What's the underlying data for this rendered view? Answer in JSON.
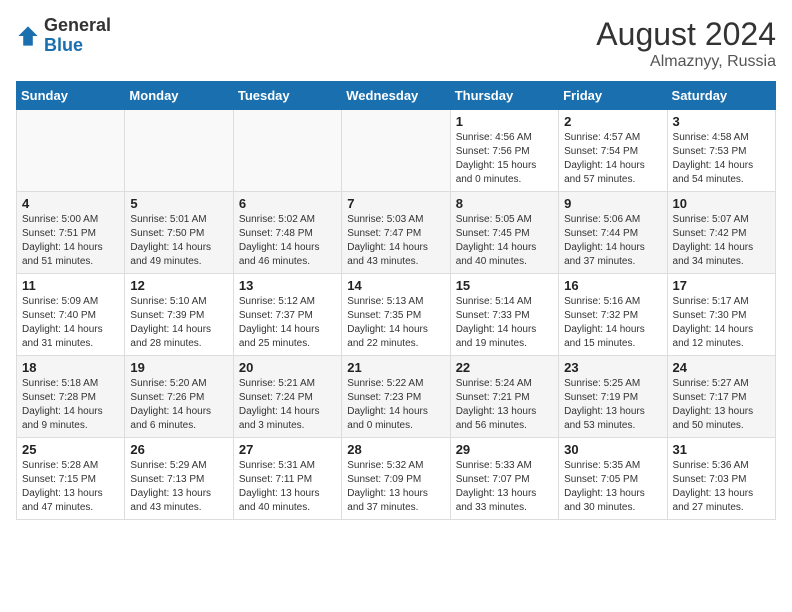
{
  "header": {
    "logo_general": "General",
    "logo_blue": "Blue",
    "month_year": "August 2024",
    "location": "Almaznyy, Russia"
  },
  "days_of_week": [
    "Sunday",
    "Monday",
    "Tuesday",
    "Wednesday",
    "Thursday",
    "Friday",
    "Saturday"
  ],
  "weeks": [
    [
      {
        "day": "",
        "content": ""
      },
      {
        "day": "",
        "content": ""
      },
      {
        "day": "",
        "content": ""
      },
      {
        "day": "",
        "content": ""
      },
      {
        "day": "1",
        "content": "Sunrise: 4:56 AM\nSunset: 7:56 PM\nDaylight: 15 hours\nand 0 minutes."
      },
      {
        "day": "2",
        "content": "Sunrise: 4:57 AM\nSunset: 7:54 PM\nDaylight: 14 hours\nand 57 minutes."
      },
      {
        "day": "3",
        "content": "Sunrise: 4:58 AM\nSunset: 7:53 PM\nDaylight: 14 hours\nand 54 minutes."
      }
    ],
    [
      {
        "day": "4",
        "content": "Sunrise: 5:00 AM\nSunset: 7:51 PM\nDaylight: 14 hours\nand 51 minutes."
      },
      {
        "day": "5",
        "content": "Sunrise: 5:01 AM\nSunset: 7:50 PM\nDaylight: 14 hours\nand 49 minutes."
      },
      {
        "day": "6",
        "content": "Sunrise: 5:02 AM\nSunset: 7:48 PM\nDaylight: 14 hours\nand 46 minutes."
      },
      {
        "day": "7",
        "content": "Sunrise: 5:03 AM\nSunset: 7:47 PM\nDaylight: 14 hours\nand 43 minutes."
      },
      {
        "day": "8",
        "content": "Sunrise: 5:05 AM\nSunset: 7:45 PM\nDaylight: 14 hours\nand 40 minutes."
      },
      {
        "day": "9",
        "content": "Sunrise: 5:06 AM\nSunset: 7:44 PM\nDaylight: 14 hours\nand 37 minutes."
      },
      {
        "day": "10",
        "content": "Sunrise: 5:07 AM\nSunset: 7:42 PM\nDaylight: 14 hours\nand 34 minutes."
      }
    ],
    [
      {
        "day": "11",
        "content": "Sunrise: 5:09 AM\nSunset: 7:40 PM\nDaylight: 14 hours\nand 31 minutes."
      },
      {
        "day": "12",
        "content": "Sunrise: 5:10 AM\nSunset: 7:39 PM\nDaylight: 14 hours\nand 28 minutes."
      },
      {
        "day": "13",
        "content": "Sunrise: 5:12 AM\nSunset: 7:37 PM\nDaylight: 14 hours\nand 25 minutes."
      },
      {
        "day": "14",
        "content": "Sunrise: 5:13 AM\nSunset: 7:35 PM\nDaylight: 14 hours\nand 22 minutes."
      },
      {
        "day": "15",
        "content": "Sunrise: 5:14 AM\nSunset: 7:33 PM\nDaylight: 14 hours\nand 19 minutes."
      },
      {
        "day": "16",
        "content": "Sunrise: 5:16 AM\nSunset: 7:32 PM\nDaylight: 14 hours\nand 15 minutes."
      },
      {
        "day": "17",
        "content": "Sunrise: 5:17 AM\nSunset: 7:30 PM\nDaylight: 14 hours\nand 12 minutes."
      }
    ],
    [
      {
        "day": "18",
        "content": "Sunrise: 5:18 AM\nSunset: 7:28 PM\nDaylight: 14 hours\nand 9 minutes."
      },
      {
        "day": "19",
        "content": "Sunrise: 5:20 AM\nSunset: 7:26 PM\nDaylight: 14 hours\nand 6 minutes."
      },
      {
        "day": "20",
        "content": "Sunrise: 5:21 AM\nSunset: 7:24 PM\nDaylight: 14 hours\nand 3 minutes."
      },
      {
        "day": "21",
        "content": "Sunrise: 5:22 AM\nSunset: 7:23 PM\nDaylight: 14 hours\nand 0 minutes."
      },
      {
        "day": "22",
        "content": "Sunrise: 5:24 AM\nSunset: 7:21 PM\nDaylight: 13 hours\nand 56 minutes."
      },
      {
        "day": "23",
        "content": "Sunrise: 5:25 AM\nSunset: 7:19 PM\nDaylight: 13 hours\nand 53 minutes."
      },
      {
        "day": "24",
        "content": "Sunrise: 5:27 AM\nSunset: 7:17 PM\nDaylight: 13 hours\nand 50 minutes."
      }
    ],
    [
      {
        "day": "25",
        "content": "Sunrise: 5:28 AM\nSunset: 7:15 PM\nDaylight: 13 hours\nand 47 minutes."
      },
      {
        "day": "26",
        "content": "Sunrise: 5:29 AM\nSunset: 7:13 PM\nDaylight: 13 hours\nand 43 minutes."
      },
      {
        "day": "27",
        "content": "Sunrise: 5:31 AM\nSunset: 7:11 PM\nDaylight: 13 hours\nand 40 minutes."
      },
      {
        "day": "28",
        "content": "Sunrise: 5:32 AM\nSunset: 7:09 PM\nDaylight: 13 hours\nand 37 minutes."
      },
      {
        "day": "29",
        "content": "Sunrise: 5:33 AM\nSunset: 7:07 PM\nDaylight: 13 hours\nand 33 minutes."
      },
      {
        "day": "30",
        "content": "Sunrise: 5:35 AM\nSunset: 7:05 PM\nDaylight: 13 hours\nand 30 minutes."
      },
      {
        "day": "31",
        "content": "Sunrise: 5:36 AM\nSunset: 7:03 PM\nDaylight: 13 hours\nand 27 minutes."
      }
    ]
  ]
}
